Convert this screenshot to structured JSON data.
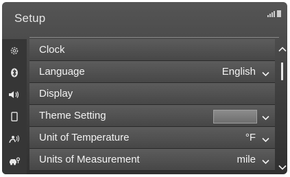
{
  "header": {
    "title": "Setup"
  },
  "menu": [
    {
      "label": "Clock",
      "value": "",
      "icon": "gear-icon"
    },
    {
      "label": "Language",
      "value": "English",
      "icon": "bluetooth-icon"
    },
    {
      "label": "Display",
      "value": "",
      "icon": "speaker-icon"
    },
    {
      "label": "Theme Setting",
      "value": "",
      "icon": "phone-icon"
    },
    {
      "label": "Unit of Temperature",
      "value": "°F",
      "icon": "voice-icon"
    },
    {
      "label": "Units of Measurement",
      "value": "mile",
      "icon": "car-icon"
    }
  ],
  "colors": {
    "background": "#3c3c3c",
    "row": "#505050",
    "text": "#f2f2f2"
  }
}
